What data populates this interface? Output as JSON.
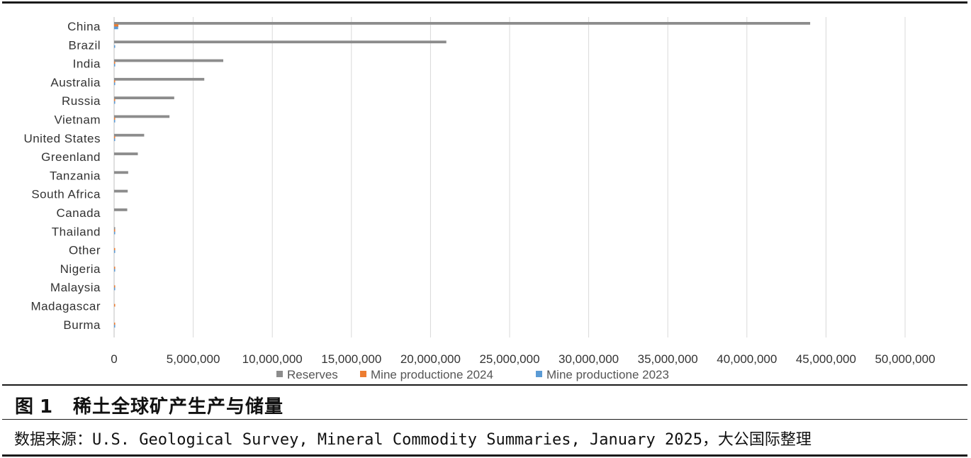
{
  "figure": {
    "number": "图 1",
    "title": "稀土全球矿产生产与储量",
    "source": "数据来源：U.S. Geological Survey, Mineral Commodity Summaries, January 2025，大公国际整理"
  },
  "chart_data": {
    "type": "bar",
    "orientation": "horizontal",
    "categories": [
      "China",
      "Brazil",
      "India",
      "Australia",
      "Russia",
      "Vietnam",
      "United States",
      "Greenland",
      "Tanzania",
      "South Africa",
      "Canada",
      "Thailand",
      "Other",
      "Nigeria",
      "Malaysia",
      "Madagascar",
      "Burma"
    ],
    "series": [
      {
        "name": "Reserves",
        "color": "#8c8c8c",
        "values": [
          44000000,
          21000000,
          6900000,
          5700000,
          3800000,
          3500000,
          1900000,
          1500000,
          890000,
          860000,
          830000,
          4500,
          0,
          0,
          0,
          0,
          0
        ]
      },
      {
        "name": "Mine productione 2024",
        "color": "#ed7d31",
        "values": [
          270000,
          0,
          2900,
          13000,
          2500,
          300,
          45000,
          0,
          0,
          0,
          0,
          13000,
          1100,
          13000,
          130,
          2000,
          31000
        ]
      },
      {
        "name": "Mine productione 2023",
        "color": "#5b9bd5",
        "values": [
          255000,
          140,
          2900,
          16000,
          2500,
          300,
          41600,
          0,
          0,
          0,
          0,
          3600,
          1100,
          7200,
          130,
          0,
          43000
        ]
      }
    ],
    "xlim": [
      0,
      50000000
    ],
    "xticks": [
      0,
      5000000,
      10000000,
      15000000,
      20000000,
      25000000,
      30000000,
      35000000,
      40000000,
      45000000,
      50000000
    ],
    "xtick_labels": [
      "0",
      "5,000,000",
      "10,000,000",
      "15,000,000",
      "20,000,000",
      "25,000,000",
      "30,000,000",
      "35,000,000",
      "40,000,000",
      "45,000,000",
      "50,000,000"
    ],
    "grid": "vertical",
    "legend_position": "bottom"
  }
}
